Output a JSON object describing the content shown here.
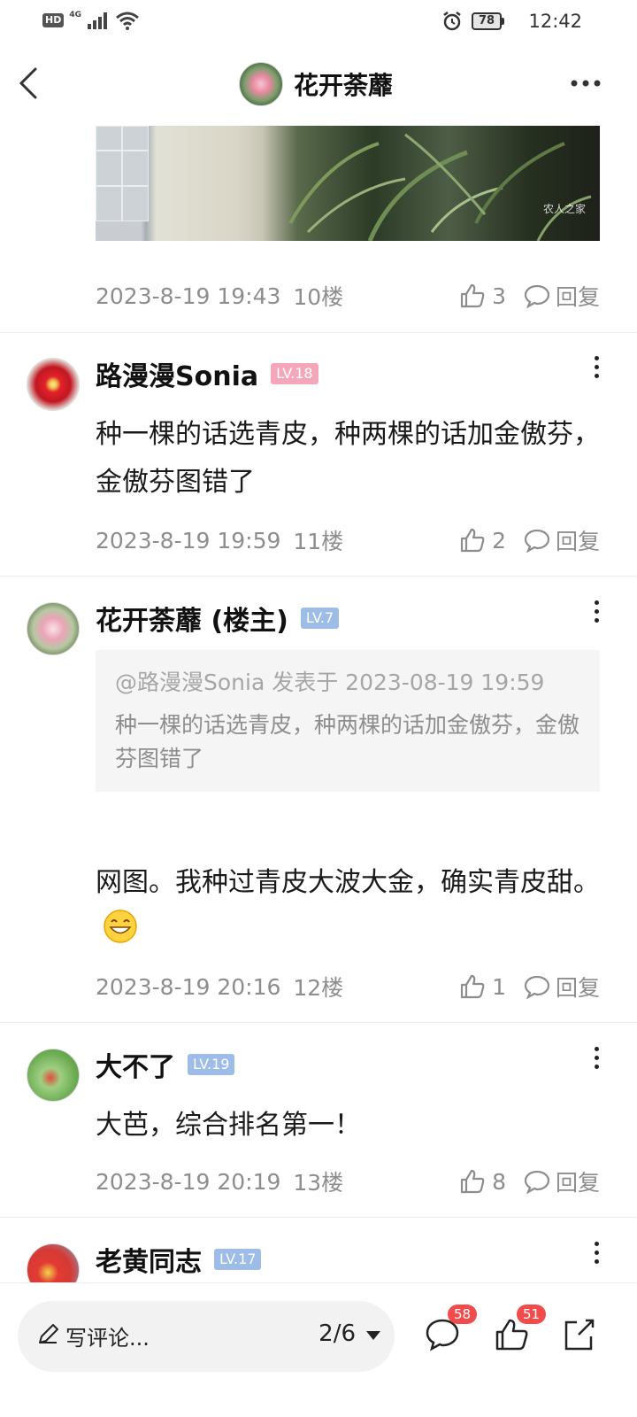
{
  "status_bar": {
    "hd": "HD",
    "network": "4G",
    "battery": "78",
    "time": "12:42"
  },
  "header": {
    "title": "花开荼蘼"
  },
  "photo": {
    "watermark": "农人之家"
  },
  "first_meta": {
    "time": "2023-8-19 19:43",
    "floor": "10楼",
    "likes": "3",
    "reply": "回复"
  },
  "posts": [
    {
      "author": "路漫漫Sonia",
      "level": "LV.18",
      "text": "种一棵的话选青皮，种两棵的话加金傲芬，金傲芬图错了",
      "time": "2023-8-19 19:59",
      "floor": "11楼",
      "likes": "2",
      "reply": "回复"
    },
    {
      "author": "花开荼蘼 (楼主)",
      "level": "LV.7",
      "quote_head": "@路漫漫Sonia 发表于 2023-08-19 19:59",
      "quote_body": "种一棵的话选青皮，种两棵的话加金傲芬，金傲芬图错了",
      "text": "网图。我种过青皮大波大金，确实青皮甜。",
      "time": "2023-8-19 20:16",
      "floor": "12楼",
      "likes": "1",
      "reply": "回复"
    },
    {
      "author": "大不了",
      "level": "LV.19",
      "text": "大芭，综合排名第一！",
      "time": "2023-8-19 20:19",
      "floor": "13楼",
      "likes": "8",
      "reply": "回复"
    },
    {
      "author": "老黄同志",
      "level": "LV.17"
    }
  ],
  "bottom_bar": {
    "comment_placeholder": "写评论...",
    "page": "2/6",
    "comment_count": "58",
    "like_count": "51"
  },
  "colors": {
    "badge_pink": "#f4a7b9",
    "badge_blue": "#9dbde8",
    "meta_gray": "#8d8d8d",
    "count_badge": "#f24b4b"
  }
}
